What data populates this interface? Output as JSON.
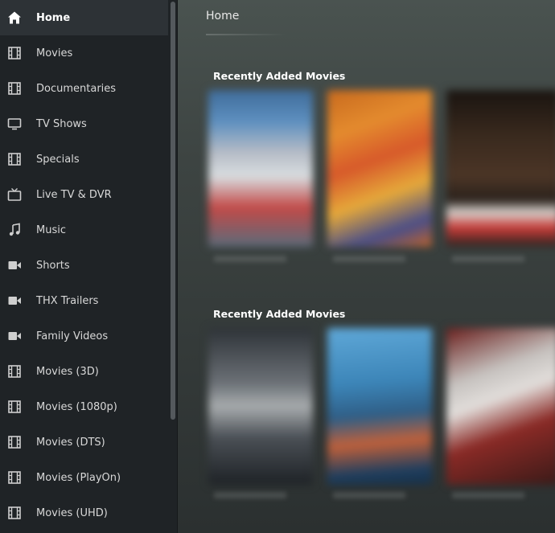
{
  "sidebar": {
    "items": [
      {
        "label": "Home",
        "icon": "home-icon",
        "active": true
      },
      {
        "label": "Movies",
        "icon": "film-icon"
      },
      {
        "label": "Documentaries",
        "icon": "film-icon"
      },
      {
        "label": "TV Shows",
        "icon": "monitor-icon"
      },
      {
        "label": "Specials",
        "icon": "film-icon"
      },
      {
        "label": "Live TV & DVR",
        "icon": "tv-icon"
      },
      {
        "label": "Music",
        "icon": "music-note-icon"
      },
      {
        "label": "Shorts",
        "icon": "video-camera-icon"
      },
      {
        "label": "THX Trailers",
        "icon": "video-camera-icon"
      },
      {
        "label": "Family Videos",
        "icon": "video-camera-icon"
      },
      {
        "label": "Movies (3D)",
        "icon": "film-icon"
      },
      {
        "label": "Movies (1080p)",
        "icon": "film-icon"
      },
      {
        "label": "Movies (DTS)",
        "icon": "film-icon"
      },
      {
        "label": "Movies (PlayOn)",
        "icon": "film-icon"
      },
      {
        "label": "Movies (UHD)",
        "icon": "film-icon"
      }
    ]
  },
  "main": {
    "title": "Home",
    "sections": [
      {
        "title": "Recently Added Movies"
      },
      {
        "title": "Recently Added Movies"
      }
    ]
  },
  "colors": {
    "sidebar_bg": "#1f2326",
    "active_item_bg": "#2d3236",
    "text": "#d8d8d8",
    "active_text": "#ffffff"
  }
}
